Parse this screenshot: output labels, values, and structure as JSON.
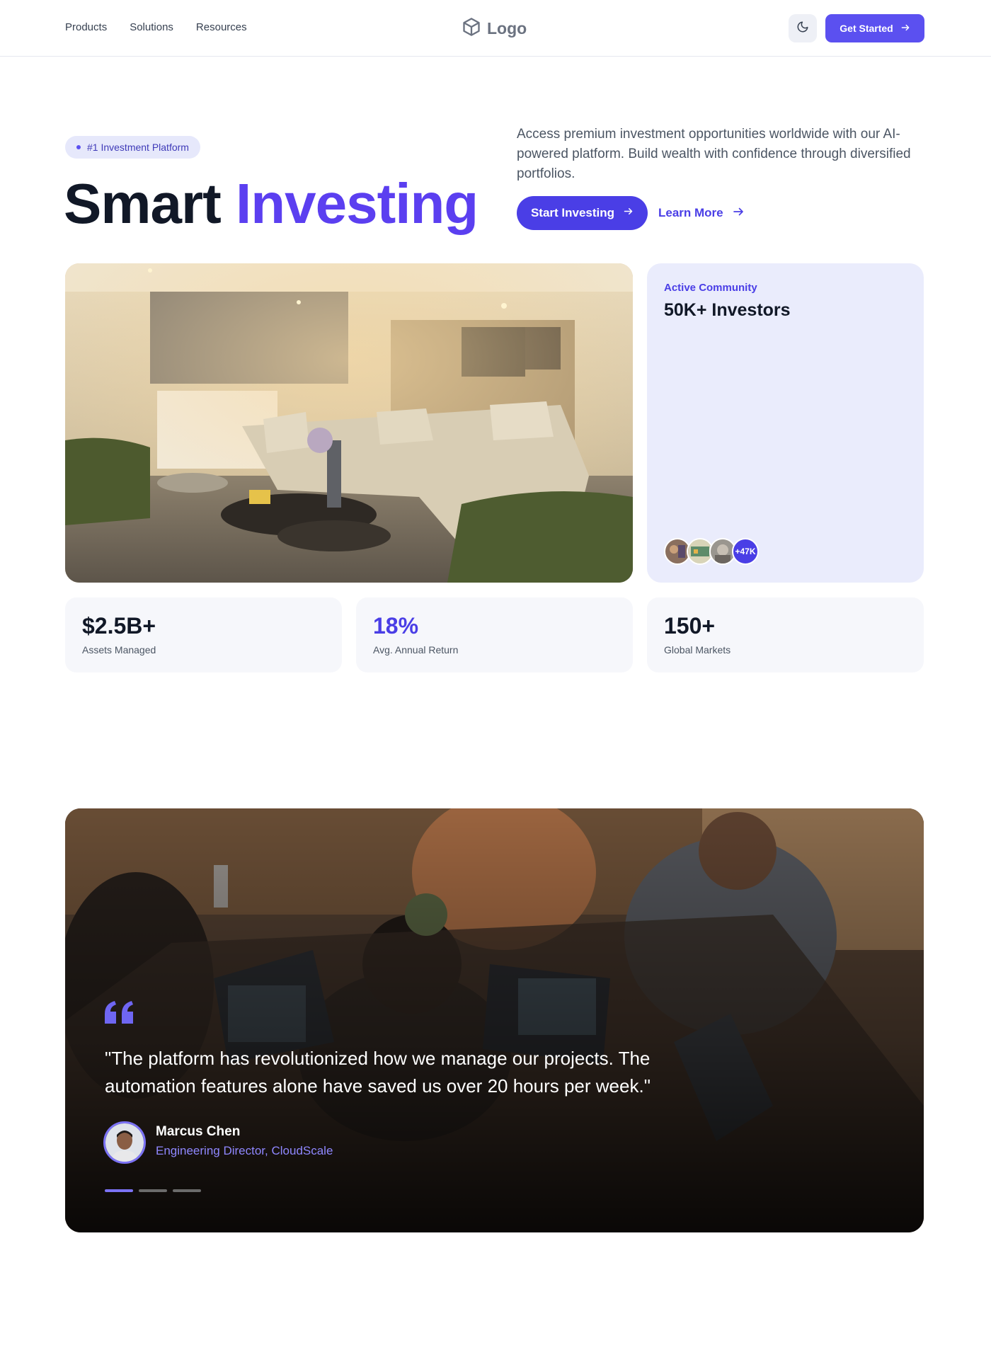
{
  "nav": {
    "links": [
      "Products",
      "Solutions",
      "Resources"
    ],
    "logo_text": "Logo",
    "theme_icon": "moon-icon",
    "cta_label": "Get Started"
  },
  "hero": {
    "badge": "#1 Investment Platform",
    "title_dark": "Smart",
    "title_accent": "Investing",
    "description": "Access premium investment opportunities worldwide with our AI-powered platform. Build wealth with confidence through diversified portfolios.",
    "primary_button": "Start Investing",
    "secondary_button": "Learn More"
  },
  "community": {
    "label": "Active Community",
    "title": "50K+ Investors",
    "avatar_count": "+47K"
  },
  "stats": [
    {
      "value": "$2.5B+",
      "label": "Assets Managed"
    },
    {
      "value": "18%",
      "label": "Avg. Annual Return"
    },
    {
      "value": "150+",
      "label": "Global Markets"
    }
  ],
  "testimonial": {
    "quote": "\"The platform has revolutionized how we manage our projects. The automation features alone have saved us over 20 hours per week.\"",
    "author_name": "Marcus Chen",
    "author_role": "Engineering Director, CloudScale",
    "slide_count": 3,
    "active_slide": 1
  },
  "colors": {
    "accent": "#5b50f0",
    "accent_dark": "#4a3ee6",
    "card_bg": "#eaecfc",
    "stat_bg": "#f6f7fb"
  }
}
